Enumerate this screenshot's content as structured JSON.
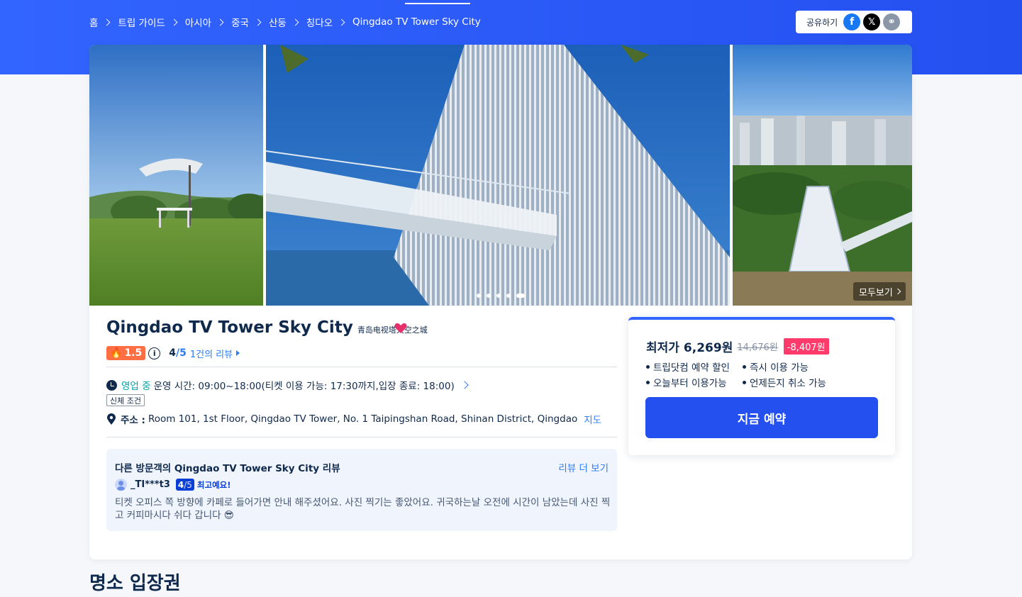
{
  "breadcrumb": [
    "홈",
    "트립 가이드",
    "아시아",
    "중국",
    "산둥",
    "칭다오",
    "Qingdao TV Tower Sky City"
  ],
  "share": {
    "label": "공유하기",
    "facebook_icon": "f",
    "x_icon": "𝕏",
    "link_icon": "⚭"
  },
  "gallery": {
    "see_all": "모두보기",
    "slide_count": 5,
    "active_slide": 5
  },
  "attraction": {
    "title": "Qingdao TV Tower Sky City",
    "subtitle": "青岛电视塔天空之城",
    "hot_score": "1.5",
    "info_glyph": "i",
    "rating": "4",
    "rating_max": "/5",
    "review_link": "1건의 리뷰",
    "status": "영업 중",
    "hours": "운영 시간: 09:00~18:00(티켓 이용 가능: 17:30까지,입장 종료: 18:00)",
    "tag": "신체 조건",
    "address_label": "주소 :",
    "address": "Room 101, 1st Floor, Qingdao TV Tower, No. 1 Taipingshan Road, Shinan District, Qingdao",
    "map_link": "지도"
  },
  "reviews": {
    "title": "다른 방문객의 Qingdao TV Tower Sky City 리뷰",
    "more": "리뷰 더 보기",
    "user": "_TI***t3",
    "score": "4",
    "score_max": "/5",
    "badge": "최고예요!",
    "text": "티켓 오피스 쪽 방향에 카페로 들어가면 안내 해주셨어요. 사진 찍기는 좋았어요. 귀국하는날 오전에 시간이 남았는데 사진 찍고 커피마시다 쉬다 갑니다 😎"
  },
  "pricing": {
    "label": "최저가",
    "price": "6,269원",
    "old_price": "14,676원",
    "discount": "-8,407원",
    "features": [
      "트립닷컴 예약 할인",
      "즉시 이용 가능",
      "오늘부터 이용가능",
      "언제든지 취소 가능"
    ],
    "book_button": "지금 예약"
  },
  "section_title": "명소 입장권",
  "colors": {
    "brand": "#3264ff",
    "accent_link": "#287dfa",
    "discount": "#ff3b6b",
    "hot": "#ff6f43",
    "open": "#00a3a8"
  }
}
